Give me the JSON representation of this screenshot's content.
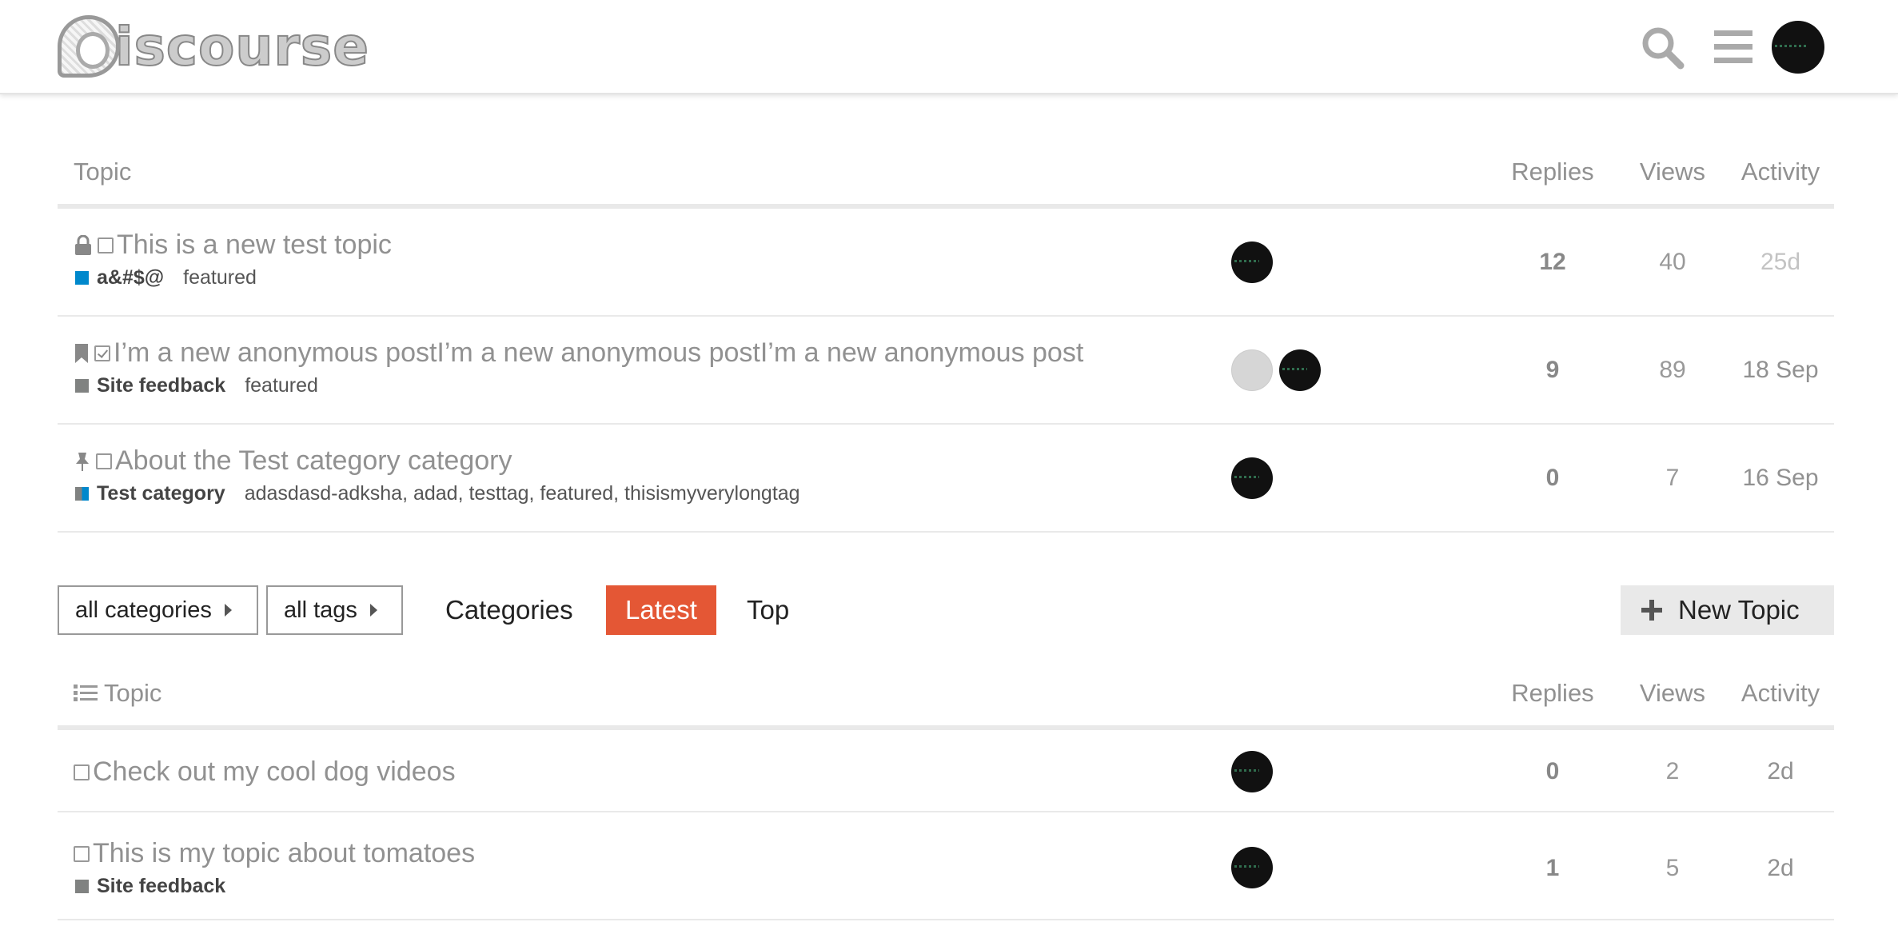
{
  "header": {
    "logo_text": "iscourse",
    "icons": [
      "search-icon",
      "hamburger-menu-icon",
      "user-avatar"
    ]
  },
  "featured": {
    "columns": {
      "topic": "Topic",
      "replies": "Replies",
      "views": "Views",
      "activity": "Activity"
    },
    "rows": [
      {
        "title": "This is a new test topic",
        "status_icons": [
          "lock-icon",
          "checkbox-unread-icon"
        ],
        "category": "a&#$@",
        "category_color": "#0088cc",
        "tags": "featured",
        "replies": "12",
        "views": "40",
        "activity": "25d"
      },
      {
        "title": "I’m a new anonymous postI’m a new anonymous postI’m a new anonymous post",
        "status_icons": [
          "bookmark-icon",
          "checkbox-checked-icon"
        ],
        "category": "Site feedback",
        "category_color": "#808281",
        "tags": "featured",
        "replies": "9",
        "views": "89",
        "activity": "18 Sep"
      },
      {
        "title": "About the Test category category",
        "status_icons": [
          "thumbtack-icon",
          "checkbox-unread-icon"
        ],
        "category": "Test category",
        "category_color": "#0088cc",
        "tags": "adasdasd-adksha, adad, testtag, featured, thisismyverylongtag",
        "replies": "0",
        "views": "7",
        "activity": "16 Sep"
      }
    ]
  },
  "nav": {
    "all_categories": "all categories",
    "all_tags": "all tags",
    "categories": "Categories",
    "latest": "Latest",
    "top": "Top",
    "new_topic": "New Topic",
    "accent": "#e45735"
  },
  "latest": {
    "columns": {
      "topic": "Topic",
      "replies": "Replies",
      "views": "Views",
      "activity": "Activity"
    },
    "rows": [
      {
        "title": "Check out my cool dog videos",
        "category": "",
        "replies": "0",
        "views": "2",
        "activity": "2d"
      },
      {
        "title": "This is my topic about tomatoes",
        "category": "Site feedback",
        "category_color": "#808281",
        "replies": "1",
        "views": "5",
        "activity": "2d"
      }
    ]
  }
}
